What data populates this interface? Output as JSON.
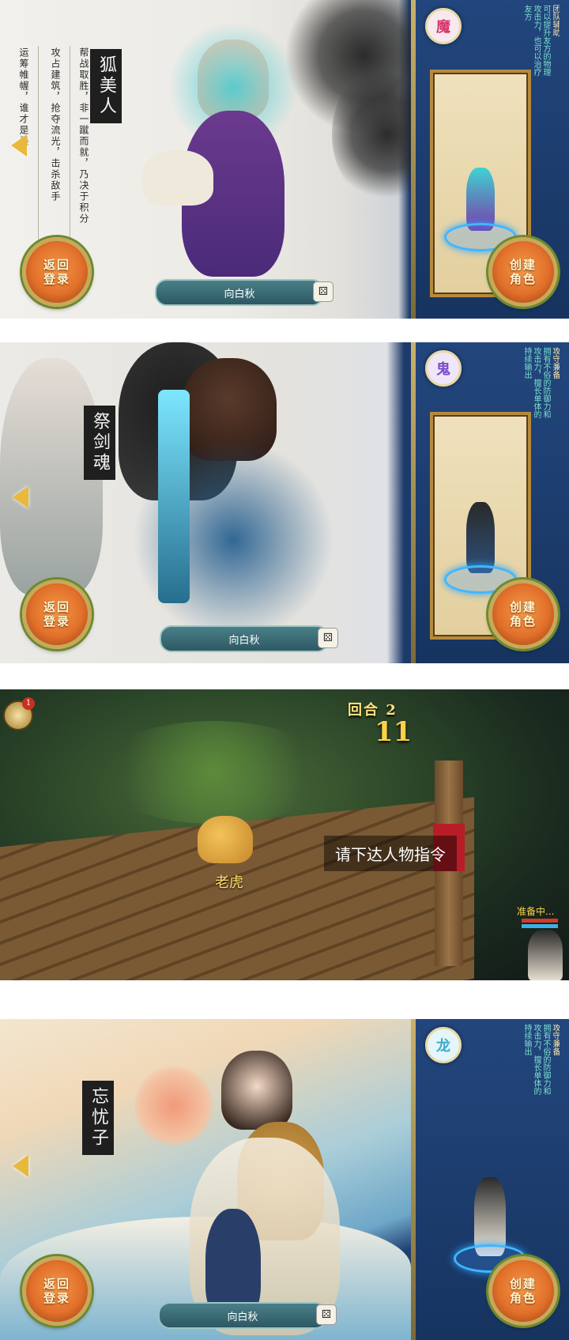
{
  "common": {
    "back_login_label": "返回登录",
    "create_role_label": "创建角色",
    "random_name": "向白秋",
    "dice_icon": "dice-icon"
  },
  "screen1": {
    "faction": "魔",
    "faction_color": "#d7356b",
    "hero_name": "狐美人",
    "desc_title": "团队辅助",
    "desc_text": "可以提升友方的物理攻击力，也可以治疗友方",
    "story_cols": [
      "帮战取胜，非一蹴而就，乃决于积分",
      "攻占建筑，抢夺流光，击杀敌手",
      "运筹帷幄，谁才是最"
    ]
  },
  "screen2": {
    "faction": "鬼",
    "faction_color": "#7a4bc9",
    "hero_name": "祭剑魂",
    "desc_title": "攻守兼备",
    "desc_text": "拥有不俗的防御力和攻击力，擅长单体的持续输出"
  },
  "screen3": {
    "round_label": "回合 2",
    "countdown": "11",
    "command_prompt": "请下达人物指令",
    "pet_name": "老虎",
    "status_text": "准备中...",
    "auto_badge": "1"
  },
  "screen4": {
    "faction": "龙",
    "faction_color": "#3fa9c9",
    "hero_name": "忘忧子",
    "desc_title": "攻守兼备",
    "desc_text": "拥有不俗的防御力和攻击力，擅长单体的持续输出"
  }
}
